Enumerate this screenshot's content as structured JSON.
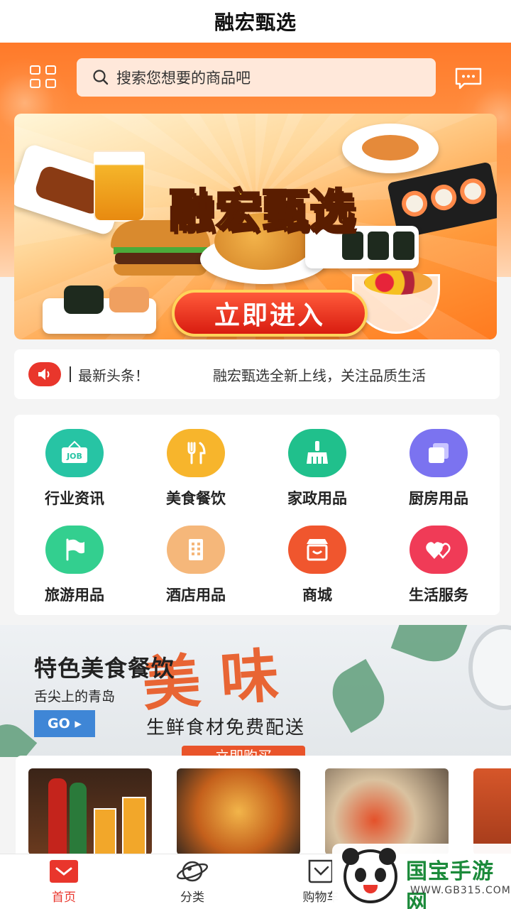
{
  "header": {
    "title": "融宏甄选"
  },
  "search": {
    "placeholder": "搜索您想要的商品吧"
  },
  "banner": {
    "title": "融宏甄选",
    "button_label": "立即进入"
  },
  "news": {
    "label": "最新头条！",
    "text": "融宏甄选全新上线，关注品质生活"
  },
  "categories": [
    {
      "label": "行业资讯",
      "icon": "job-sign-icon",
      "color": "#27c4a4"
    },
    {
      "label": "美食餐饮",
      "icon": "fork-knife-icon",
      "color": "#f7b52c"
    },
    {
      "label": "家政用品",
      "icon": "broom-icon",
      "color": "#20c08c"
    },
    {
      "label": "厨房用品",
      "icon": "square-icon",
      "color": "#7b73f0"
    },
    {
      "label": "旅游用品",
      "icon": "flag-icon",
      "color": "#33cf8f"
    },
    {
      "label": "酒店用品",
      "icon": "building-icon",
      "color": "#f5b77a"
    },
    {
      "label": "商城",
      "icon": "shop-icon",
      "color": "#f0562e"
    },
    {
      "label": "生活服务",
      "icon": "hearts-icon",
      "color": "#f03b57"
    }
  ],
  "promo": {
    "title": "特色美食餐饮",
    "subtitle": "舌尖上的青岛",
    "go_label": "GO ▸",
    "headline": "美味",
    "tagline": "生鲜食材免费配送",
    "cta": "立即购买"
  },
  "tabbar": {
    "tabs": [
      {
        "label": "首页",
        "icon": "home-icon",
        "active": true
      },
      {
        "label": "分类",
        "icon": "planet-icon",
        "active": false
      },
      {
        "label": "购物车",
        "icon": "cart-icon",
        "active": false
      }
    ]
  },
  "watermark": {
    "brand": "国宝手游网",
    "url": "WWW.GB315.COM"
  },
  "colors": {
    "accent": "#e9362c",
    "header_orange": "#ff7a2a",
    "go_blue": "#3f86d6"
  }
}
